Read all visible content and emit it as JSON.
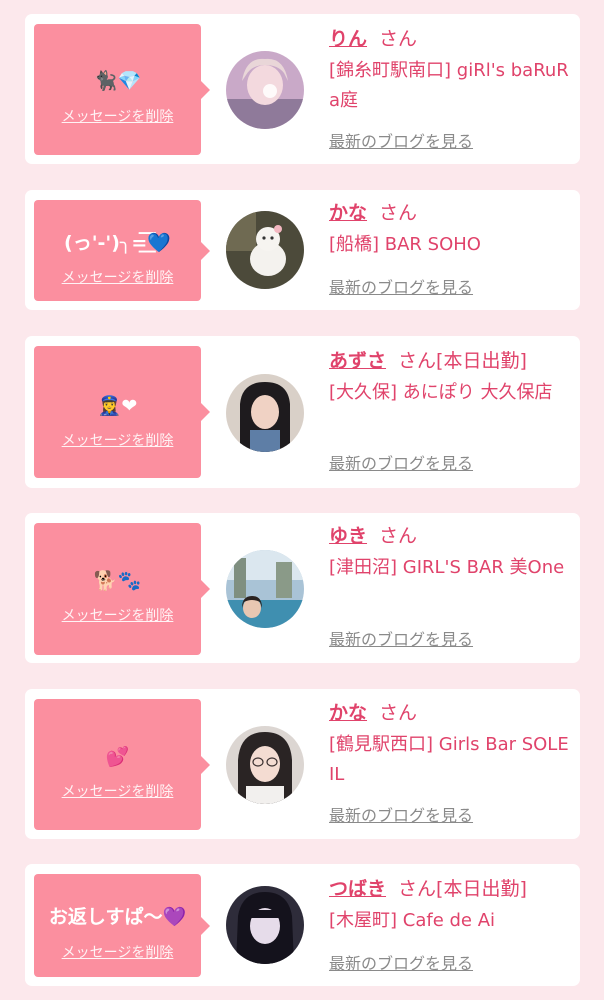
{
  "colors": {
    "page_background": "#fce8ec",
    "card_background": "#ffffff",
    "bubble_pink": "#fb8f9f",
    "name_accent": "#e0436b",
    "link_gray": "#8a8a8a"
  },
  "cards": [
    {
      "message": "🐈‍⬛💎",
      "delete_label": "メッセージを削除",
      "name": "りん",
      "honorific": "さん",
      "status": "",
      "shop": "[錦糸町駅南口] giRl's baRuRa庭",
      "blog_link": "最新のブログを見る",
      "avatar": "profile-photo"
    },
    {
      "message": "(っ'-')╮=͟͟͞͞💙",
      "delete_label": "メッセージを削除",
      "name": "かな",
      "honorific": "さん",
      "status": "",
      "shop": "[船橋] BAR SOHO",
      "blog_link": "最新のブログを見る",
      "avatar": "profile-photo"
    },
    {
      "message": "👮‍♀️❤",
      "delete_label": "メッセージを削除",
      "name": "あずさ",
      "honorific": "さん",
      "status": "[本日出勤]",
      "shop": "[大久保] あにぽり 大久保店",
      "blog_link": "最新のブログを見る",
      "avatar": "profile-photo"
    },
    {
      "message": "🐕🐾",
      "delete_label": "メッセージを削除",
      "name": "ゆき",
      "honorific": "さん",
      "status": "",
      "shop": "[津田沼] GIRL'S BAR 美One",
      "blog_link": "最新のブログを見る",
      "avatar": "profile-photo"
    },
    {
      "message": "💕",
      "delete_label": "メッセージを削除",
      "name": "かな",
      "honorific": "さん",
      "status": "",
      "shop": "[鶴見駅西口] Girls Bar SOLEIL",
      "blog_link": "最新のブログを見る",
      "avatar": "profile-photo"
    },
    {
      "message": "お返しすぱ〜💜",
      "delete_label": "メッセージを削除",
      "name": "つばき",
      "honorific": "さん",
      "status": "[本日出勤]",
      "shop": "[木屋町] Cafe de Ai",
      "blog_link": "最新のブログを見る",
      "avatar": "profile-photo"
    }
  ]
}
